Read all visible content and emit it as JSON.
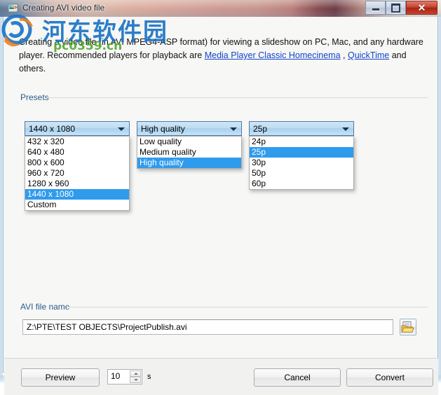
{
  "window": {
    "title": "Creating AVI video file",
    "icon": "avi-video-file-icon",
    "controls": {
      "minimize": "minimize-icon",
      "maximize": "maximize-icon",
      "close": "✕"
    }
  },
  "description": {
    "part1": "Creating a video file (in AVI MPEG4-ASP format) for viewing a slideshow on PC, Mac, and any hardware player. Recommended players for playback are ",
    "link1": "Media Player Classic Homecinema",
    "sep": " , ",
    "link2": "QuickTime",
    "part2": " and others."
  },
  "presets": {
    "label": "Presets",
    "resolution": {
      "selected": "1440 x 1080",
      "options": [
        "432 x 320",
        "640 x 480",
        "800 x 600",
        "960 x 720",
        "1280 x 960",
        "1440 x 1080",
        "Custom"
      ],
      "selected_index": 5
    },
    "quality": {
      "selected": "High quality",
      "options": [
        "Low quality",
        "Medium quality",
        "High quality"
      ],
      "selected_index": 2
    },
    "framerate": {
      "selected": "25p",
      "options": [
        "24p",
        "25p",
        "30p",
        "50p",
        "60p"
      ],
      "selected_index": 1
    }
  },
  "file_section": {
    "label": "AVI file name",
    "path": "Z:\\PTE\\TEST OBJECTS\\ProjectPublish.avi",
    "browse_icon": "folder-open-icon"
  },
  "footer": {
    "preview_label": "Preview",
    "duration_value": "10",
    "duration_unit": "s",
    "cancel_label": "Cancel",
    "convert_label": "Convert"
  },
  "watermark": {
    "site_name": "河东软件园",
    "site_url": "pc0359.cn"
  },
  "colors": {
    "highlight": "#2f9bec",
    "group_label": "#2a5a8c",
    "link": "#1144cc",
    "close_button": "#aa2414",
    "watermark_blue": "#1b74c6",
    "watermark_green": "#53a832"
  }
}
